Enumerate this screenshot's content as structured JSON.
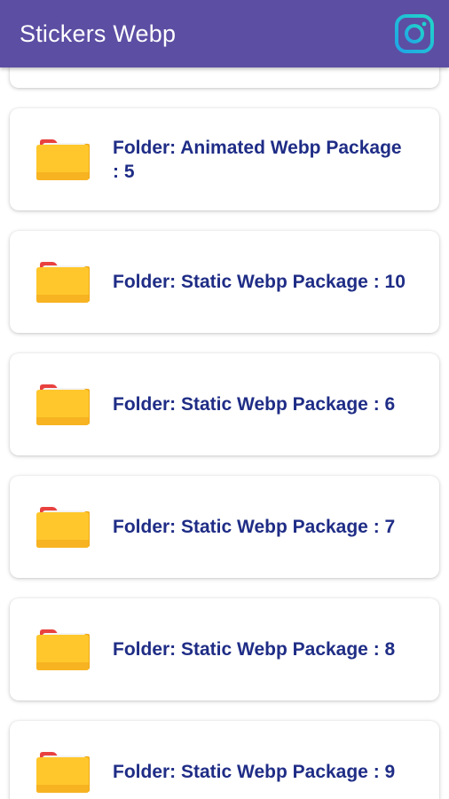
{
  "app": {
    "title": "Stickers Webp",
    "colors": {
      "appbar": "#5c4ea3",
      "label": "#1f2d86",
      "folder": "#ffc72c",
      "folder_tab": "#e8413f"
    }
  },
  "header": {
    "instagram_icon": "instagram-icon"
  },
  "folders": [
    {
      "label": ""
    },
    {
      "label": "Folder: Animated Webp Package : 5"
    },
    {
      "label": "Folder: Static Webp Package : 10"
    },
    {
      "label": "Folder: Static Webp Package : 6"
    },
    {
      "label": "Folder: Static Webp Package : 7"
    },
    {
      "label": "Folder: Static Webp Package : 8"
    },
    {
      "label": "Folder: Static Webp Package : 9"
    }
  ]
}
